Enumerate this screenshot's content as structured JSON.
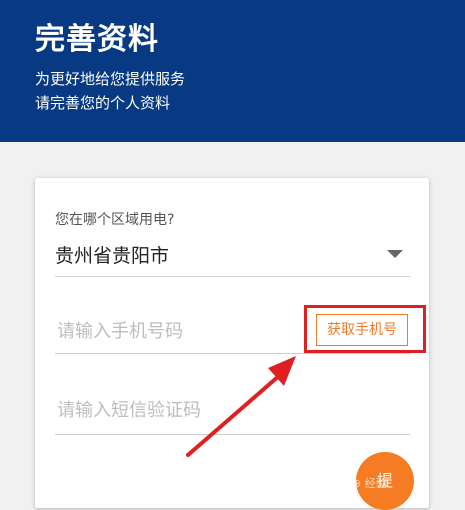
{
  "header": {
    "title": "完善资料",
    "subtitle1": "为更好地给您提供服务",
    "subtitle2": "请完善您的个人资料"
  },
  "form": {
    "region_label": "您在哪个区域用电?",
    "region_value": "贵州省贵阳市",
    "phone_placeholder": "请输入手机号码",
    "get_code_label": "获取手机号",
    "sms_placeholder": "请输入短信验证码"
  },
  "fab": {
    "label": "提"
  },
  "watermark": {
    "text": "⊕ 经验"
  },
  "colors": {
    "header_bg": "#073a82",
    "accent": "#f07a2a",
    "highlight": "#e02020"
  }
}
